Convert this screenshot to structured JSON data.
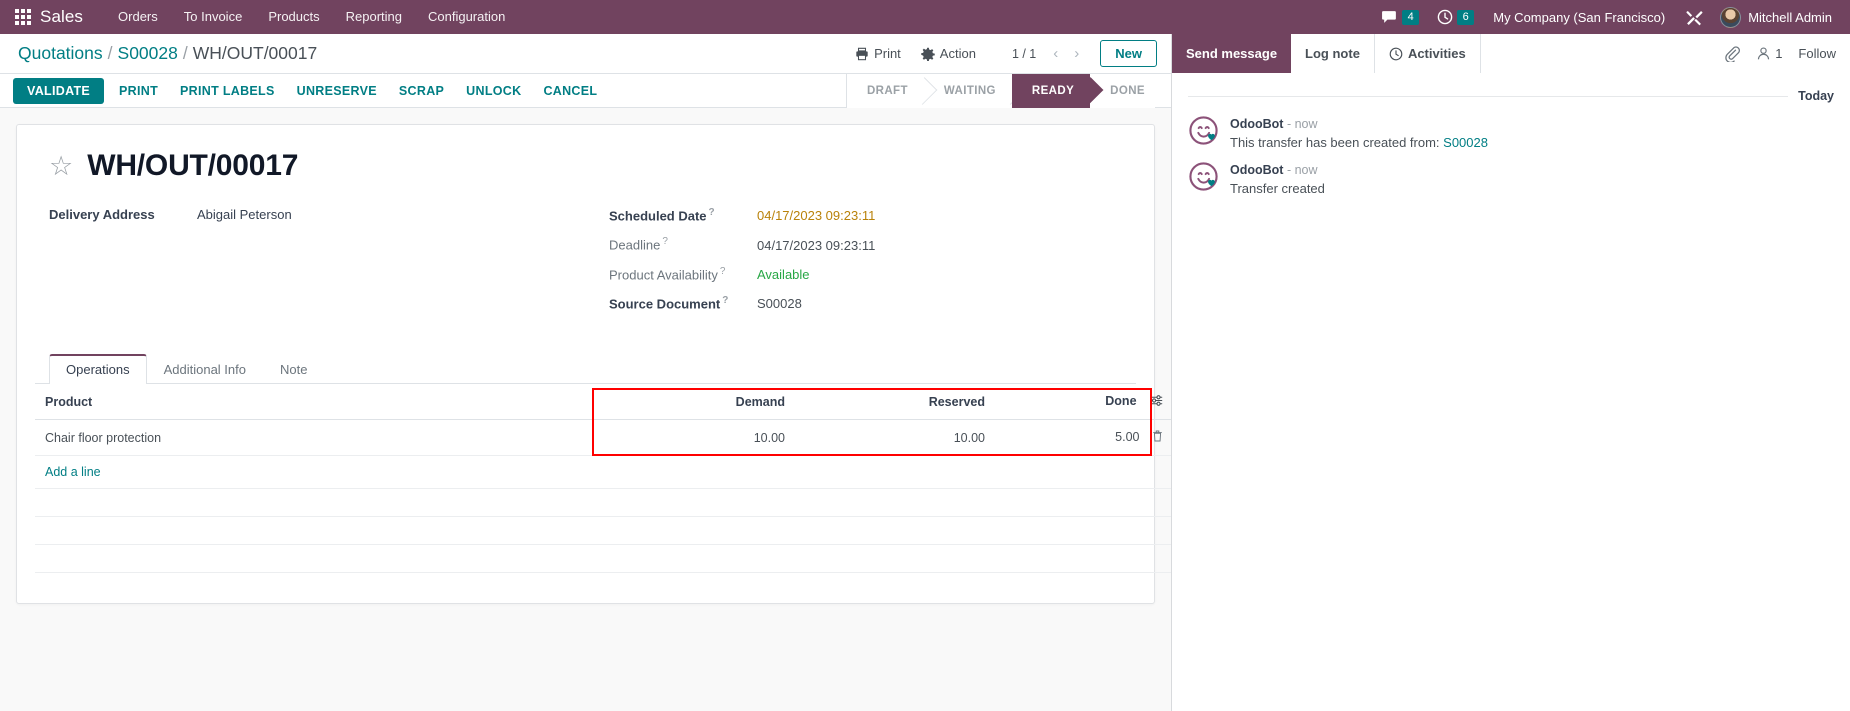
{
  "navbar": {
    "apps_icon": "apps-grid-icon",
    "brand": "Sales",
    "menu": [
      "Orders",
      "To Invoice",
      "Products",
      "Reporting",
      "Configuration"
    ],
    "messages_count": "4",
    "activities_count": "6",
    "company": "My Company (San Francisco)",
    "tools_icon": "tools-icon",
    "user_name": "Mitchell Admin",
    "bg_color": "#71435f"
  },
  "control_panel": {
    "breadcrumb": [
      "Quotations",
      "S00028",
      "WH/OUT/00017"
    ],
    "print_label": "Print",
    "action_label": "Action",
    "pager": "1 / 1",
    "new_label": "New"
  },
  "statusbar": {
    "buttons": [
      "VALIDATE",
      "PRINT",
      "PRINT LABELS",
      "UNRESERVE",
      "SCRAP",
      "UNLOCK",
      "CANCEL"
    ],
    "stages": [
      "DRAFT",
      "WAITING",
      "READY",
      "DONE"
    ],
    "active_stage": "READY",
    "active_color": "#71435f",
    "primary_color": "#017e84"
  },
  "form": {
    "title": "WH/OUT/00017",
    "star_icon": "star-icon",
    "left_fields": [
      {
        "label": "Delivery Address",
        "value": "Abigail Peterson",
        "bold": true,
        "help": false
      }
    ],
    "right_fields": [
      {
        "label": "Scheduled Date",
        "value": "04/17/2023 09:23:11",
        "bold": true,
        "help": true,
        "style": "orange"
      },
      {
        "label": "Deadline",
        "value": "04/17/2023 09:23:11",
        "bold": false,
        "help": true,
        "style": "muted"
      },
      {
        "label": "Product Availability",
        "value": "Available",
        "bold": false,
        "help": true,
        "style": "green"
      },
      {
        "label": "Source Document",
        "value": "S00028",
        "bold": true,
        "help": true,
        "style": "muted"
      }
    ]
  },
  "notebook": {
    "tabs": [
      "Operations",
      "Additional Info",
      "Note"
    ],
    "active_tab": "Operations"
  },
  "table": {
    "headers": [
      "Product",
      "Demand",
      "Reserved",
      "Done"
    ],
    "optional_columns_icon": "column-options-icon",
    "rows": [
      {
        "product": "Chair floor protection",
        "demand": "10.00",
        "reserved": "10.00",
        "done": "5.00",
        "delete_icon": "trash-icon"
      }
    ],
    "add_line_label": "Add a line",
    "highlight_color": "#ff0000"
  },
  "chatter": {
    "send_message_label": "Send message",
    "log_note_label": "Log note",
    "activities_label": "Activities",
    "activities_icon": "clock-icon",
    "attachment_icon": "paperclip-icon",
    "followers_icon": "user-icon",
    "followers_count": "1",
    "follow_label": "Follow",
    "day_separator": "Today",
    "messages": [
      {
        "avatar_icon": "odoobot-avatar",
        "author": "OdooBot",
        "time": "- now",
        "text": "This transfer has been created from: ",
        "link": "S00028"
      },
      {
        "avatar_icon": "odoobot-avatar",
        "author": "OdooBot",
        "time": "- now",
        "text": "Transfer created",
        "link": ""
      }
    ]
  }
}
